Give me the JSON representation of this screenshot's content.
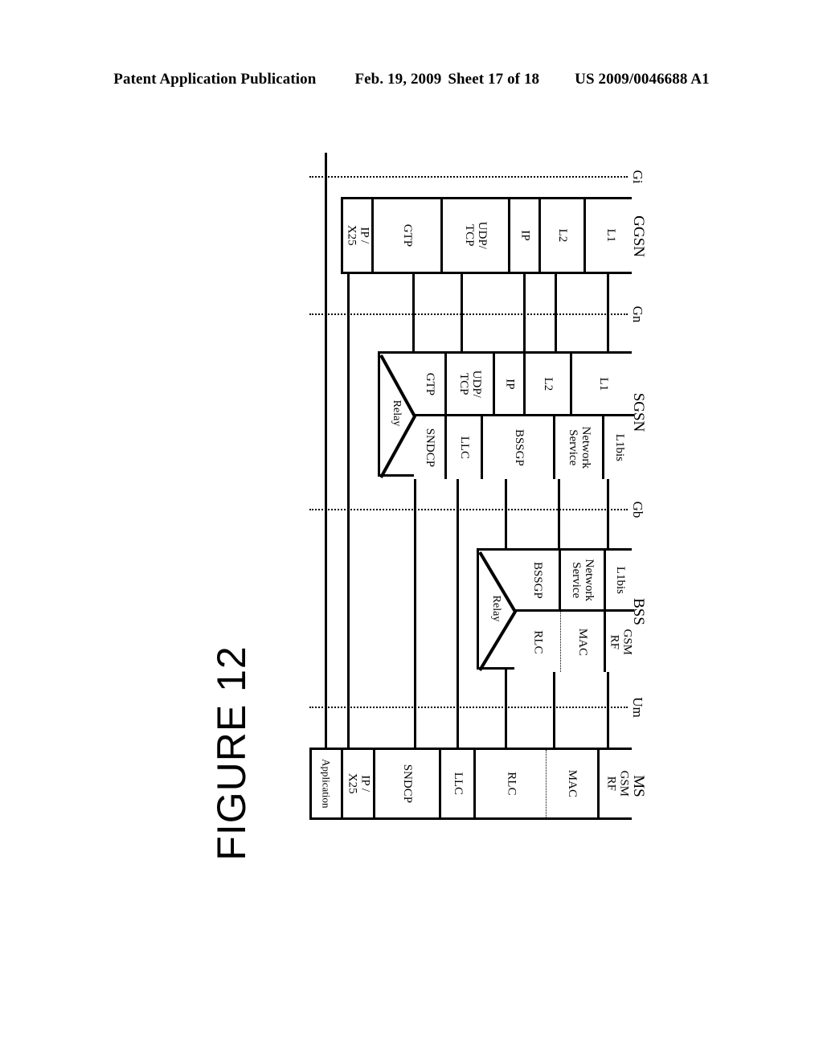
{
  "header": {
    "publication": "Patent Application Publication",
    "date": "Feb. 19, 2009",
    "sheet": "Sheet 17 of 18",
    "patent_number": "US 2009/0046688 A1"
  },
  "figure": {
    "title": "FIGURE 12"
  },
  "diagram": {
    "type": "gprs-transmission-plane-protocol-stack",
    "nodes": [
      {
        "id": "ms",
        "label": "MS"
      },
      {
        "id": "bss",
        "label": "BSS"
      },
      {
        "id": "sgsn",
        "label": "SGSN"
      },
      {
        "id": "ggsn",
        "label": "GGSN"
      }
    ],
    "interfaces": [
      {
        "id": "um",
        "label": "Um"
      },
      {
        "id": "gb",
        "label": "Gb"
      },
      {
        "id": "gn",
        "label": "Gn"
      },
      {
        "id": "gi",
        "label": "Gi"
      }
    ],
    "relay_label": "Relay",
    "stacks": {
      "ms": {
        "node": "MS",
        "layers": [
          "Application",
          "IP / X25",
          "SNDCP",
          "LLC",
          "RLC",
          "MAC",
          "GSM RF"
        ]
      },
      "bss": {
        "node": "BSS",
        "upper_layers": [
          "BSSGP",
          "Network\nService",
          "L1bis"
        ],
        "lower_layers": [
          "RLC",
          "MAC",
          "GSM RF"
        ],
        "has_relay": true
      },
      "sgsn": {
        "node": "SGSN",
        "upper_layers": [
          "GTP",
          "UDP/\nTCP",
          "IP",
          "L2",
          "L1"
        ],
        "lower_layers": [
          "SNDCP",
          "LLC",
          "BSSGP",
          "Network\nService",
          "L1bis"
        ],
        "has_relay": true
      },
      "ggsn": {
        "node": "GGSN",
        "layers": [
          "IP / X25",
          "GTP",
          "UDP/\nTCP",
          "IP",
          "L2",
          "L1"
        ]
      }
    }
  }
}
